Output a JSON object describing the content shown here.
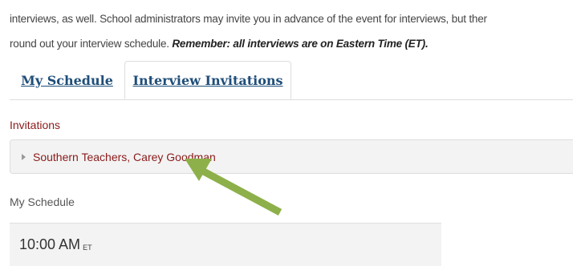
{
  "intro": {
    "line1": "interviews, as well.  School administrators may invite you in advance of the event for interviews, but ther",
    "line2_prefix": "round out your interview schedule.  ",
    "line2_remember": "Remember:",
    "line2_rest": "  all interviews are on Eastern Time (ET)."
  },
  "tabs": {
    "schedule_label": "My Schedule",
    "invitations_label": "Interview Invitations"
  },
  "invitations": {
    "title": "Invitations",
    "items": [
      {
        "label": "Southern Teachers, Carey Goodman"
      }
    ]
  },
  "schedule": {
    "title": "My Schedule",
    "slots": [
      {
        "time": "10:00 AM",
        "zone": "ET"
      }
    ]
  },
  "colors": {
    "tab_link": "#1f4e79",
    "invitation_text": "#8b1a1a",
    "arrow": "#8db04a"
  },
  "annotation": {
    "icon": "pointer-arrow-icon"
  }
}
